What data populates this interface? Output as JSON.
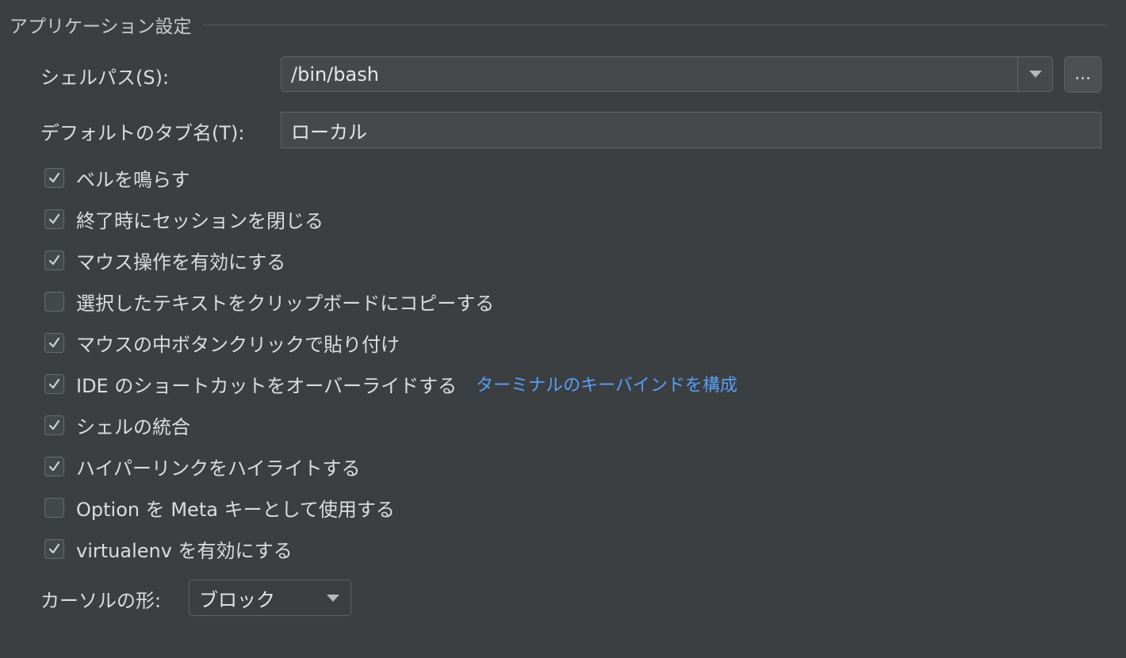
{
  "section": {
    "title": "アプリケーション設定"
  },
  "shell_path": {
    "label": "シェルパス(S):",
    "value": "/bin/bash",
    "browse_label": "..."
  },
  "default_tab": {
    "label": "デフォルトのタブ名(T):",
    "value": "ローカル"
  },
  "options": [
    {
      "label": "ベルを鳴らす",
      "checked": true
    },
    {
      "label": "終了時にセッションを閉じる",
      "checked": true
    },
    {
      "label": "マウス操作を有効にする",
      "checked": true
    },
    {
      "label": "選択したテキストをクリップボードにコピーする",
      "checked": false
    },
    {
      "label": "マウスの中ボタンクリックで貼り付け",
      "checked": true
    },
    {
      "label": "IDE のショートカットをオーバーライドする",
      "checked": true,
      "link": "ターミナルのキーバインドを構成"
    },
    {
      "label": "シェルの統合",
      "checked": true
    },
    {
      "label": "ハイパーリンクをハイライトする",
      "checked": true
    },
    {
      "label": "Option を Meta キーとして使用する",
      "checked": false
    },
    {
      "label": "virtualenv を有効にする",
      "checked": true
    }
  ],
  "cursor_shape": {
    "label": "カーソルの形:",
    "value": "ブロック"
  },
  "icons": {
    "combo_arrow": "chevron-down-icon",
    "checkmark": "checkmark-icon"
  },
  "colors": {
    "background": "#3c3f41",
    "field": "#45494a",
    "link": "#589df6",
    "text": "#dcdcdc"
  }
}
